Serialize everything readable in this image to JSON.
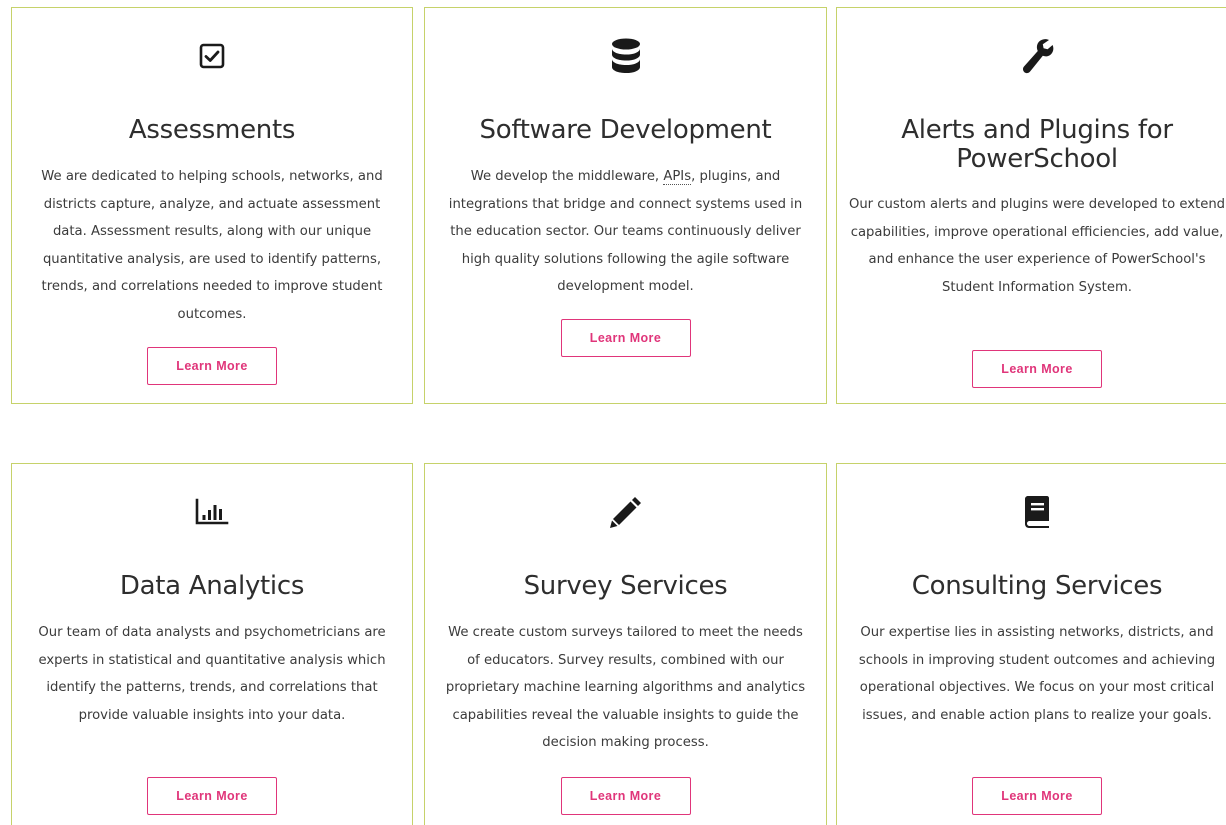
{
  "cards": [
    {
      "icon": "checkbox-icon",
      "title": "Assessments",
      "description": "We are dedicated to helping schools, networks, and districts capture, analyze, and actuate assessment data. Assessment results, along with our unique quantitative analysis, are used to identify patterns, trends, and correlations needed to improve student outcomes.",
      "button": "Learn More"
    },
    {
      "icon": "database-icon",
      "title": "Software Development",
      "description_before": "We develop the middleware, ",
      "description_abbr": "APIs",
      "description_after": ", plugins, and integrations that bridge and connect systems used in the education sector. Our teams continuously deliver high quality solutions following the agile software development model.",
      "button": "Learn More"
    },
    {
      "icon": "wrench-icon",
      "title": "Alerts and Plugins for PowerSchool",
      "description": "Our custom alerts and plugins were developed to extend capabilities, improve operational efficiencies, add value, and enhance the user experience of PowerSchool's Student Information System.",
      "button": "Learn More"
    },
    {
      "icon": "bar-chart-icon",
      "title": "Data Analytics",
      "description": "Our team of data analysts and psychometricians are experts in statistical and quantitative analysis which identify the patterns, trends, and correlations that provide valuable insights into your data.",
      "button": "Learn More"
    },
    {
      "icon": "pencil-icon",
      "title": "Survey Services",
      "description": "We create custom surveys tailored to meet the needs of educators. Survey results, combined with our proprietary machine learning algorithms and analytics capabilities reveal the valuable insights to guide the decision making process.",
      "button": "Learn More"
    },
    {
      "icon": "book-icon",
      "title": "Consulting Services",
      "description": "Our expertise lies in assisting networks, districts, and schools in improving student outcomes and achieving operational objectives. We focus on your most critical issues, and enable action plans to realize your goals.",
      "button": "Learn More"
    }
  ]
}
